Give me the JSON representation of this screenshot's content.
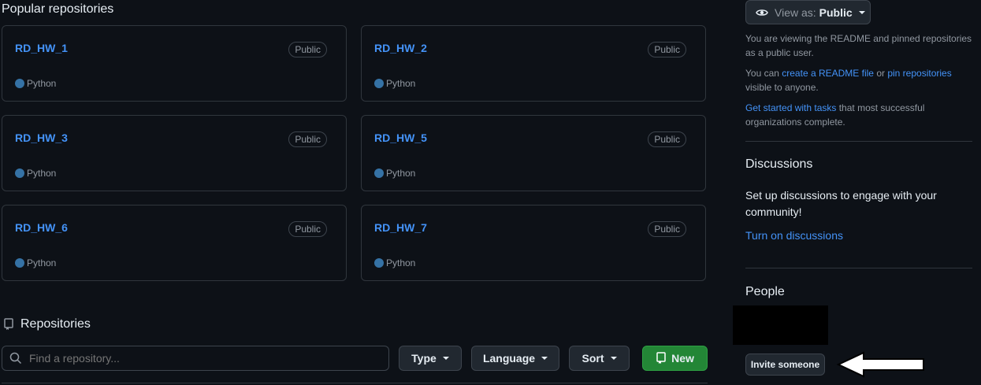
{
  "popular": {
    "title": "Popular repositories",
    "cards": [
      {
        "name": "RD_HW_1",
        "visibility": "Public",
        "language": "Python"
      },
      {
        "name": "RD_HW_2",
        "visibility": "Public",
        "language": "Python"
      },
      {
        "name": "RD_HW_3",
        "visibility": "Public",
        "language": "Python"
      },
      {
        "name": "RD_HW_5",
        "visibility": "Public",
        "language": "Python"
      },
      {
        "name": "RD_HW_6",
        "visibility": "Public",
        "language": "Python"
      },
      {
        "name": "RD_HW_7",
        "visibility": "Public",
        "language": "Python"
      }
    ],
    "language_color": "#3572A5"
  },
  "repositories": {
    "title": "Repositories",
    "search_placeholder": "Find a repository...",
    "type_label": "Type",
    "language_label": "Language",
    "sort_label": "Sort",
    "new_label": "New"
  },
  "sidebar": {
    "view_as_prefix": "View as:",
    "view_as_value": "Public",
    "viewing_text": "You are viewing the README and pinned repositories as a public user.",
    "can_prefix": "You can ",
    "create_readme_link": "create a README file",
    "or_text": " or ",
    "pin_link": "pin repositories",
    "visible_text": " visible to anyone.",
    "get_started_link": "Get started with tasks",
    "get_started_rest": " that most successful organizations complete.",
    "discussions_title": "Discussions",
    "discussions_text": "Set up discussions to engage with your community!",
    "discussions_link": "Turn on discussions",
    "people_title": "People",
    "invite_label": "Invite someone"
  },
  "colors": {
    "background": "#0d1117",
    "link": "#4493f8",
    "new_button": "#238636"
  }
}
